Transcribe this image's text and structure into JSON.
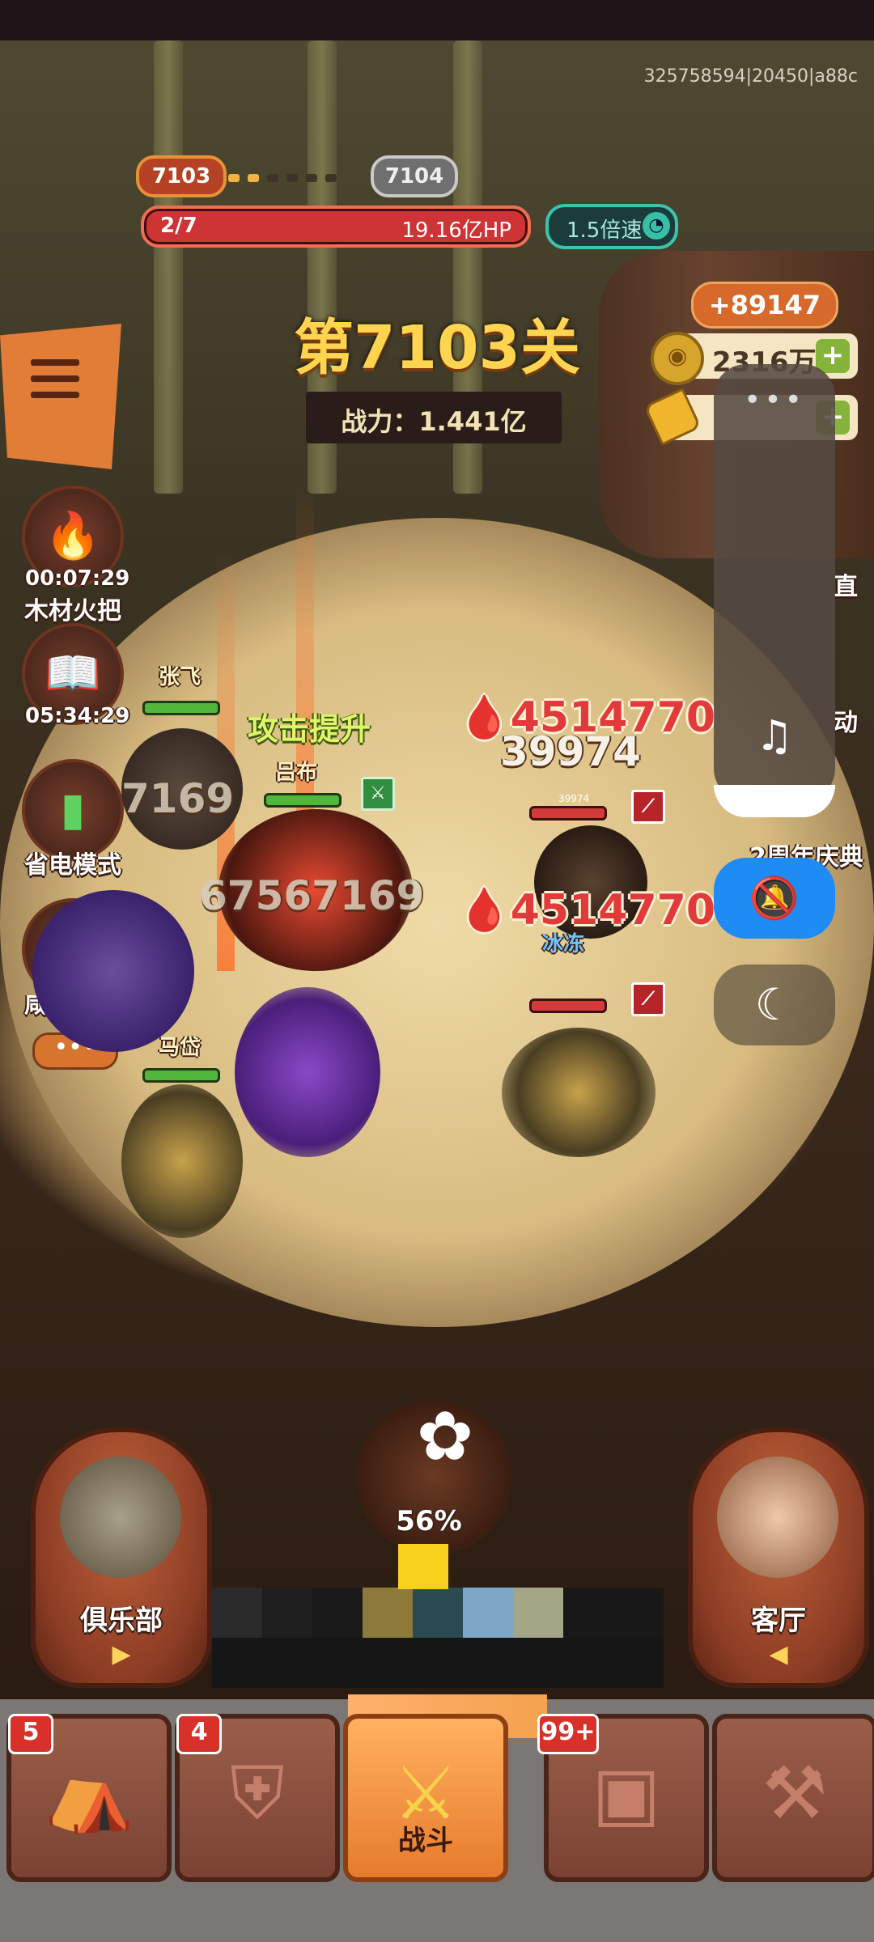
{
  "session_id": "325758594|20450|a88c",
  "level": {
    "current": "7103",
    "next": "7104"
  },
  "boss_hp": {
    "stage": "2/7",
    "value": "19.16亿HP"
  },
  "speed": {
    "label": "1.5倍速"
  },
  "stage_title": "第7103关",
  "power": "战力：1.441亿",
  "resources": {
    "gain": "+89147",
    "coins": "2316万"
  },
  "side_items": [
    {
      "label": "木材火把",
      "timer": "00:07:29",
      "icon": "torch-icon"
    },
    {
      "label": "",
      "timer": "05:34:29",
      "icon": "book-icon"
    },
    {
      "label": "省电模式",
      "timer": "",
      "icon": "battery-icon"
    },
    {
      "label": "咸鱼卡牌",
      "timer": "",
      "icon": "cards-icon"
    }
  ],
  "side_more": "•••",
  "right_labels": [
    "直",
    "动",
    "2周年庆典"
  ],
  "overlay": {
    "dots": "•••",
    "music": "♫",
    "mute": "🔕",
    "moon": "☾"
  },
  "battle": {
    "heroes": [
      "张飞",
      "吕布",
      "马岱"
    ],
    "enemy_name": "冰冻",
    "buff": "攻击提升",
    "damage_main_1": "4514770",
    "damage_main_2": "4514770",
    "damage_sub": "39974",
    "damage_tiny": "39974",
    "damage_left_1": "7169",
    "damage_left_2": "67567169"
  },
  "potion": {
    "percent": "56%"
  },
  "bottom_buttons": {
    "left": "俱乐部",
    "right": "客厅",
    "left_arrow": "▶",
    "right_arrow": "◀"
  },
  "nav": {
    "tabs": [
      {
        "badge": "5",
        "label": "",
        "icon": "backpack-icon"
      },
      {
        "badge": "4",
        "label": "",
        "icon": "armor-icon"
      },
      {
        "badge": "",
        "label": "战斗",
        "icon": "battle-icon"
      },
      {
        "badge": "99+",
        "label": "",
        "icon": "chest-icon"
      },
      {
        "badge": "",
        "label": "",
        "icon": "map-icon"
      }
    ]
  }
}
